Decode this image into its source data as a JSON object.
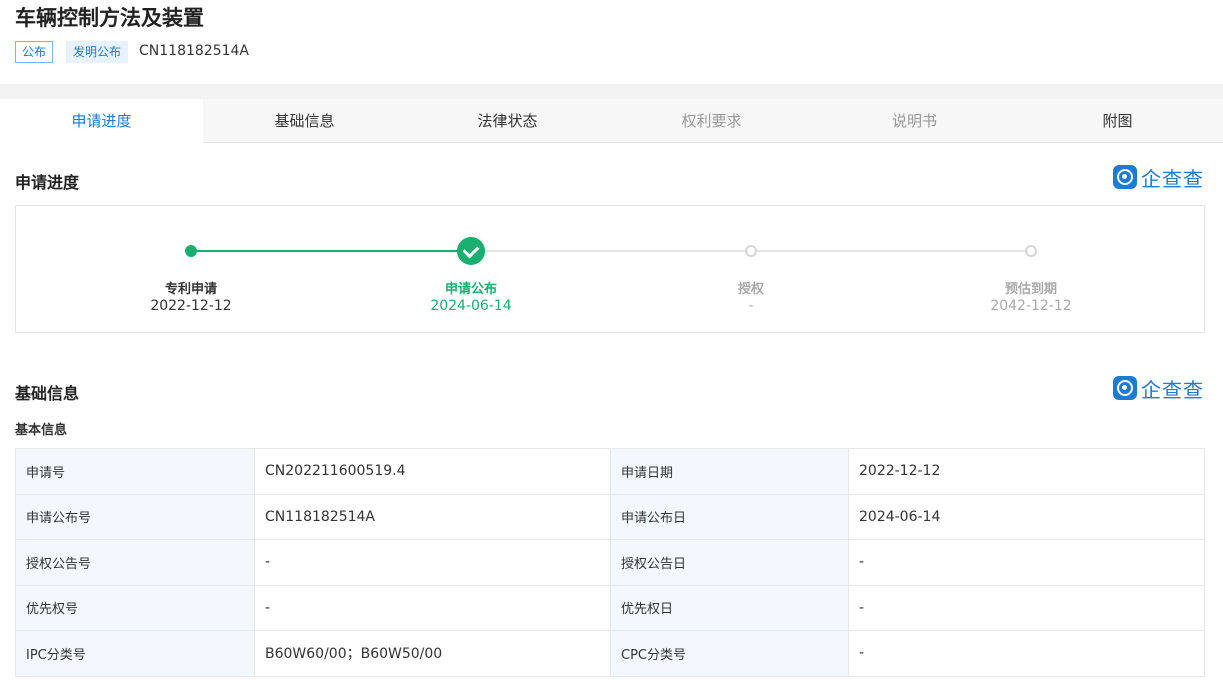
{
  "header": {
    "title": "车辆控制方法及装置",
    "tags": [
      "公布",
      "发明公布"
    ],
    "pub_no": "CN118182514A"
  },
  "tabs": [
    {
      "label": "申请进度",
      "state": "active"
    },
    {
      "label": "基础信息",
      "state": "normal"
    },
    {
      "label": "法律状态",
      "state": "normal"
    },
    {
      "label": "权利要求",
      "state": "disabled"
    },
    {
      "label": "说明书",
      "state": "disabled"
    },
    {
      "label": "附图",
      "state": "normal"
    }
  ],
  "brand": {
    "logo_text": "企查查",
    "color": "#1f7ad1"
  },
  "progress": {
    "title": "申请进度",
    "steps": [
      {
        "label": "专利申请",
        "date": "2022-12-12",
        "status": "done"
      },
      {
        "label": "申请公布",
        "date": "2024-06-14",
        "status": "current"
      },
      {
        "label": "授权",
        "date": "-",
        "status": "pending"
      },
      {
        "label": "预估到期",
        "date": "2042-12-12",
        "status": "pending"
      }
    ],
    "colors": {
      "done": "#1aae6f",
      "pending": "#d6d6d6"
    }
  },
  "basic": {
    "title": "基础信息",
    "subtitle": "基本信息",
    "rows": [
      {
        "k1": "申请号",
        "v1": "CN202211600519.4",
        "k2": "申请日期",
        "v2": "2022-12-12"
      },
      {
        "k1": "申请公布号",
        "v1": "CN118182514A",
        "k2": "申请公布日",
        "v2": "2024-06-14"
      },
      {
        "k1": "授权公告号",
        "v1": "-",
        "k2": "授权公告日",
        "v2": "-"
      },
      {
        "k1": "优先权号",
        "v1": "-",
        "k2": "优先权日",
        "v2": "-"
      },
      {
        "k1": "IPC分类号",
        "v1": "B60W60/00；B60W50/00",
        "k2": "CPC分类号",
        "v2": "-"
      }
    ]
  }
}
